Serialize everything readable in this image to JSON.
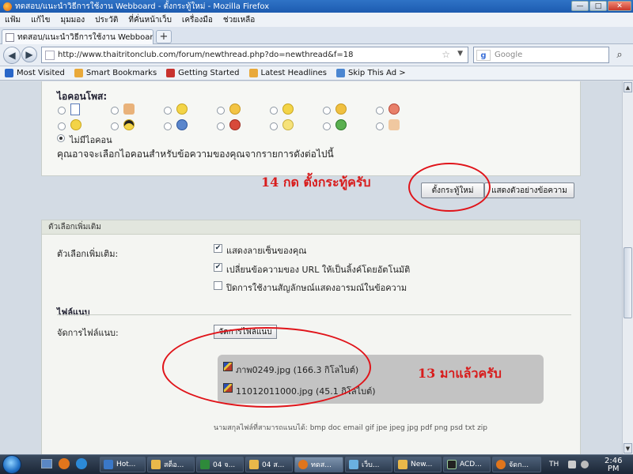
{
  "window": {
    "title": "ทดสอบ/แนะนำวิธีการใช้งาน Webboard - ตั้งกระทู้ใหม่ - Mozilla Firefox",
    "controls": [
      "—",
      "□",
      "✕"
    ]
  },
  "menu": [
    "แฟ้ม",
    "แก้ไข",
    "มุมมอง",
    "ประวัติ",
    "ที่คั่นหน้าเว็บ",
    "เครื่องมือ",
    "ช่วยเหลือ"
  ],
  "tab": {
    "label": "ทดสอบ/แนะนำวิธีการใช้งาน Webboard - ตั้ง...",
    "new_tab": "+"
  },
  "nav": {
    "url": "http://www.thaitritonclub.com/forum/newthread.php?do=newthread&f=18",
    "search_placeholder": "Google"
  },
  "bookmarks": [
    {
      "label": "Most Visited",
      "color": "#2a67c8"
    },
    {
      "label": "Smart Bookmarks",
      "color": "#e9a93a"
    },
    {
      "label": "Getting Started",
      "color": "#c8322e"
    },
    {
      "label": "Latest Headlines",
      "color": "#e9a93a"
    },
    {
      "label": "Skip This Ad >",
      "color": "#4b86d1"
    }
  ],
  "post_icons": {
    "title": "ไอคอนโพส:",
    "no_icon_label": "ไม่มีไอคอน",
    "hint": "คุณอาจจะเลือกไอคอนสำหรับข้อความของคุณจากรายการดังต่อไปนี้",
    "icons_row1": [
      "document-icon",
      "thumbs-down-icon",
      "smile-icon",
      "grin-icon",
      "neutral-icon",
      "sad-icon",
      "angry-icon"
    ],
    "icons_row2": [
      "happy-icon",
      "cool-icon",
      "question-icon",
      "exclamation-icon",
      "lightbulb-icon",
      "arrow-icon",
      "thumbs-up-icon"
    ]
  },
  "annotation_14": "14 กด ตั้งกระทู้ครับ",
  "buttons": {
    "submit": "ตั้งกระทู้ใหม่",
    "preview": "แสดงตัวอย่างข้อความ"
  },
  "options": {
    "header": "ตัวเลือกเพิ่มเติม",
    "label": "ตัวเลือกเพิ่มเติม:",
    "items": [
      {
        "label": "แสดงลายเซ็นของคุณ",
        "checked": true
      },
      {
        "label": "เปลี่ยนข้อความของ URL ให้เป็นลิ้งค์โดยอัตโนมัติ",
        "checked": true
      },
      {
        "label": "ปิดการใช้งานสัญลักษณ์แสดงอารมณ์ในข้อความ",
        "checked": false
      }
    ]
  },
  "attachments": {
    "title": "ไฟล์แนบ",
    "label": "จัดการไฟล์แนบ:",
    "manage_button": "จัดการไฟล์แนบ",
    "files": [
      "ภาพ0249.jpg (166.3 กิโลไบต์)",
      "11012011000.jpg (45.1 กิโลไบต์)"
    ],
    "allowed": "นามสกุลไฟล์ที่สามารถแนบได้: bmp doc email gif jpe jpeg jpg pdf png psd txt zip"
  },
  "annotation_13": "13 มาแล้วครับ",
  "annotation_color": "#d81c1c",
  "taskbar": {
    "items": [
      "Hot...",
      "สต็อ...",
      "04 จ...",
      "04 ส...",
      "ทดส...",
      "เว็บ...",
      "New...",
      "ACD...",
      "จัดก..."
    ],
    "lang": "TH",
    "time": "2:46",
    "ampm": "PM"
  }
}
